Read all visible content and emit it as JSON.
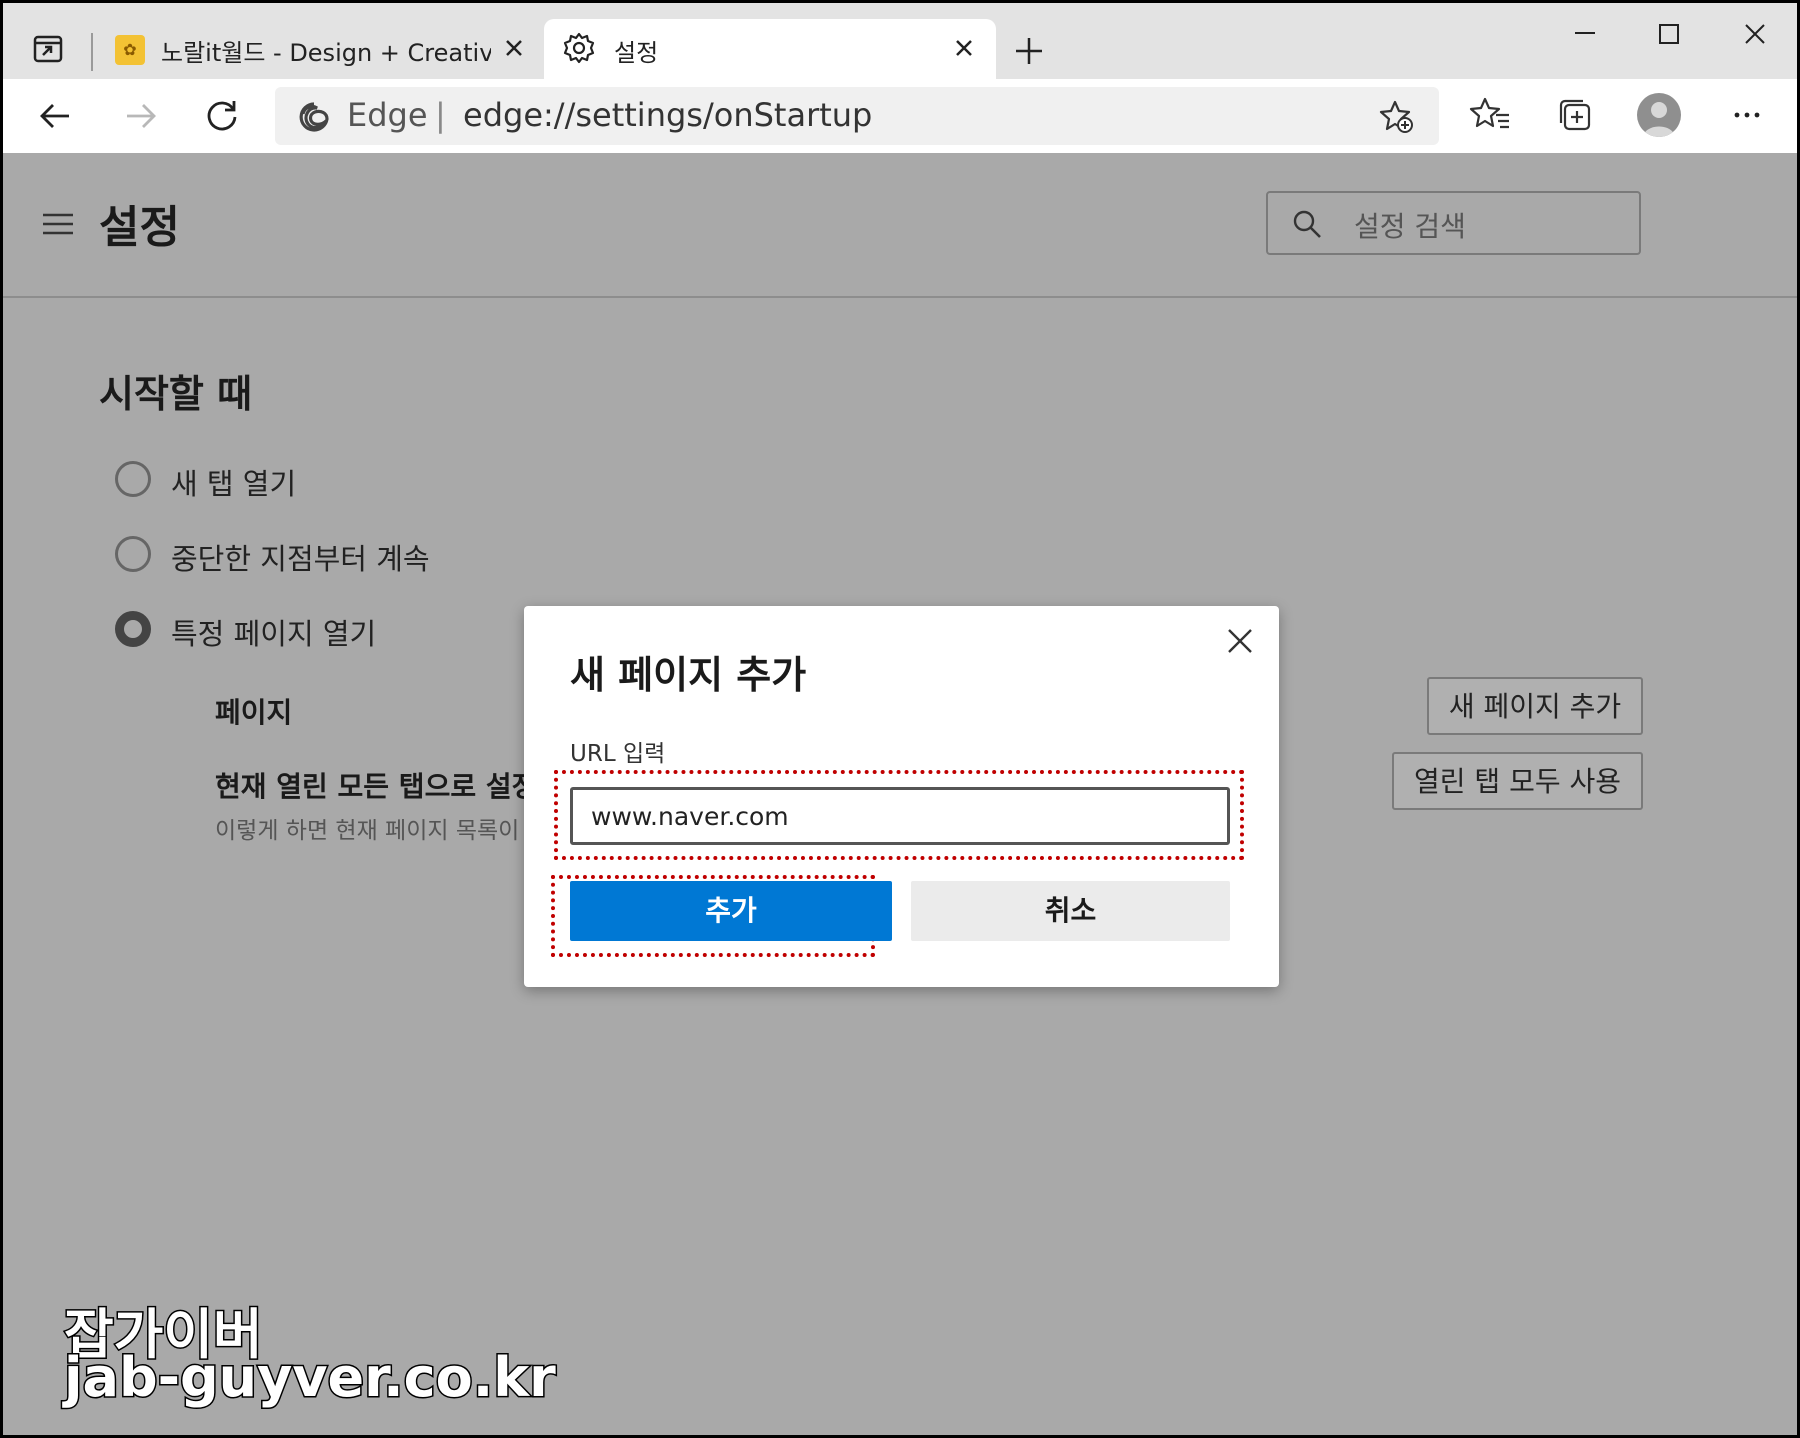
{
  "browser": {
    "tabs": [
      {
        "title": "노랄it월드 - Design + Creative + ",
        "favicon": "favicon-icon",
        "active": false
      },
      {
        "title": "설정",
        "favicon": "gear-icon",
        "active": true
      }
    ],
    "address": {
      "brand": "Edge",
      "separator": "|",
      "url": "edge://settings/onStartup"
    },
    "icons": [
      "back-icon",
      "forward-icon",
      "refresh-icon",
      "edge-logo-icon",
      "add-favorite-icon",
      "favorites-icon",
      "collections-icon",
      "profile-avatar",
      "more-icon",
      "minimize-icon",
      "maximize-icon",
      "close-window-icon",
      "new-tab-icon",
      "tab-actions-icon"
    ]
  },
  "settings": {
    "title": "설정",
    "search_placeholder": "설정 검색",
    "section_heading": "시작할 때",
    "radio_options": [
      {
        "label": "새 탭 열기",
        "checked": false
      },
      {
        "label": "중단한 지점부터 계속",
        "checked": false
      },
      {
        "label": "특정 페이지 열기",
        "checked": true
      }
    ],
    "pages_label": "페이지",
    "current_tabs_label": "현재 열린 모든 탭으로 설정",
    "current_tabs_desc": "이렇게 하면 현재 페이지 목록이",
    "add_page_button": "새 페이지 추가",
    "use_all_tabs_button": "열린 탭 모두 사용"
  },
  "dialog": {
    "title": "새 페이지 추가",
    "url_label": "URL 입력",
    "url_value": "www.naver.com",
    "add_label": "추가",
    "cancel_label": "취소"
  },
  "watermark": {
    "name": "잡가이버",
    "site": "jab-guyver.co.kr"
  },
  "colors": {
    "accent": "#0078d4",
    "highlight": "#c00000",
    "overlay": "#a9a9a9"
  }
}
